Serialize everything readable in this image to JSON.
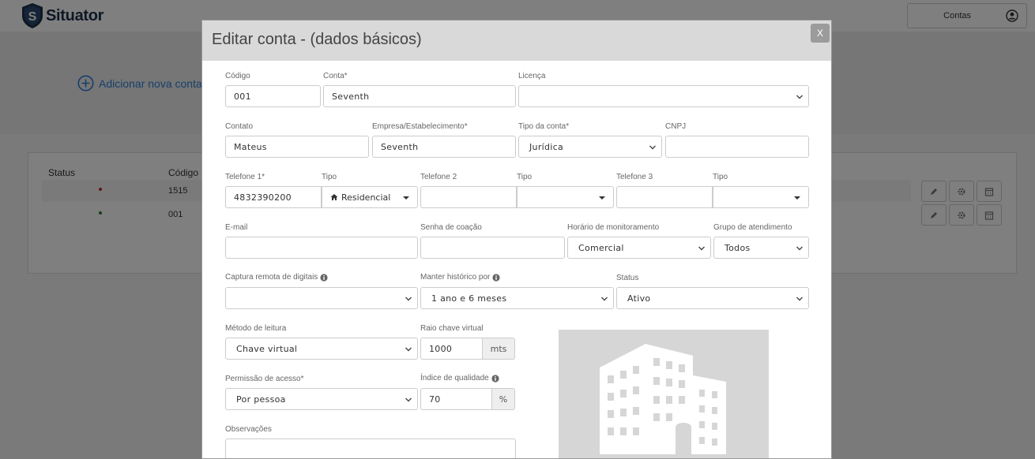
{
  "app": {
    "logo_text": "Situator",
    "user_label": "Contas"
  },
  "background": {
    "add_link": "Adicionar nova conta",
    "table": {
      "headers": [
        "Status",
        "Código"
      ],
      "rows": [
        {
          "status_color": "#c62828",
          "code": "1515"
        },
        {
          "status_color": "#2e7d32",
          "code": "001"
        }
      ]
    }
  },
  "modal": {
    "title": "Editar conta - (dados básicos)",
    "close_label": "X",
    "fields": {
      "codigo": {
        "label": "Código",
        "value": "001"
      },
      "conta": {
        "label": "Conta*",
        "value": "Seventh"
      },
      "licenca": {
        "label": "Licença",
        "value": ""
      },
      "contato": {
        "label": "Contato",
        "value": "Mateus"
      },
      "empresa": {
        "label": "Empresa/Estabelecimento*",
        "value": "Seventh"
      },
      "tipo_conta": {
        "label": "Tipo da conta*",
        "value": "Jurídica"
      },
      "cnpj": {
        "label": "CNPJ",
        "value": ""
      },
      "telefone1": {
        "label": "Telefone 1*",
        "value": "4832390200"
      },
      "tipo1": {
        "label": "Tipo",
        "value": "Residencial"
      },
      "telefone2": {
        "label": "Telefone 2",
        "value": ""
      },
      "tipo2": {
        "label": "Tipo",
        "value": ""
      },
      "telefone3": {
        "label": "Telefone 3",
        "value": ""
      },
      "tipo3": {
        "label": "Tipo",
        "value": ""
      },
      "email": {
        "label": "E-mail",
        "value": ""
      },
      "senha_coacao": {
        "label": "Senha de coação",
        "value": ""
      },
      "horario": {
        "label": "Horário de monitoramento",
        "value": "Comercial"
      },
      "grupo": {
        "label": "Grupo de atendimento",
        "value": "Todos"
      },
      "captura": {
        "label": "Captura remota de digitais",
        "value": ""
      },
      "historico": {
        "label": "Manter histórico por",
        "value": "1 ano e 6 meses"
      },
      "status": {
        "label": "Status",
        "value": "Ativo"
      },
      "metodo": {
        "label": "Método de leitura",
        "value": "Chave virtual"
      },
      "raio": {
        "label": "Raio chave virtual",
        "value": "1000",
        "unit": "mts"
      },
      "permissao": {
        "label": "Permissão de acesso*",
        "value": "Por pessoa"
      },
      "indice": {
        "label": "Índice de qualidade",
        "value": "70",
        "unit": "%"
      },
      "observacoes": {
        "label": "Observações",
        "value": ""
      }
    }
  },
  "colors": {
    "accent": "#2d7fd6",
    "brand": "#1b3149"
  }
}
